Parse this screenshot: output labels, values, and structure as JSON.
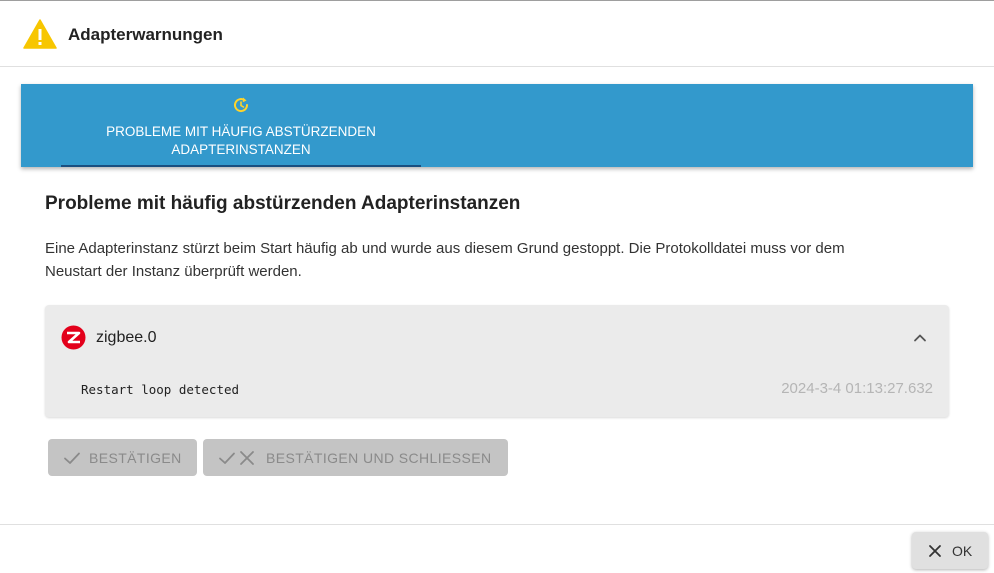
{
  "dialog": {
    "title": "Adapterwarnungen",
    "title_icon": "warning-triangle-icon"
  },
  "tabs": [
    {
      "label_line1": "Probleme mit häufig abstürzenden",
      "label_line2": "Adapterinstanzen",
      "icon": "restart-icon",
      "selected": true
    }
  ],
  "section": {
    "title": "Probleme mit häufig abstürzenden Adapterinstanzen",
    "description_line1": "Eine Adapterinstanz stürzt beim Start häufig ab und wurde aus diesem Grund gestoppt. Die Protokolldatei muss vor dem",
    "description_line2": "Neustart der Instanz überprüft werden."
  },
  "instance": {
    "name": "zigbee.0",
    "logo": "zigbee-logo-icon",
    "expanded": true,
    "message": "Restart loop detected",
    "timestamp": "2024-3-4 01:13:27.632"
  },
  "actions": {
    "confirm_label": "Bestätigen",
    "confirm_close_label": "Bestätigen und schliessen",
    "disabled": true
  },
  "footer": {
    "ok_label": "OK"
  },
  "colors": {
    "tabbar": "#3399cc",
    "warning": "#f7c600",
    "tab_icon": "#ffd42a",
    "zigbee_red": "#e3001b"
  }
}
